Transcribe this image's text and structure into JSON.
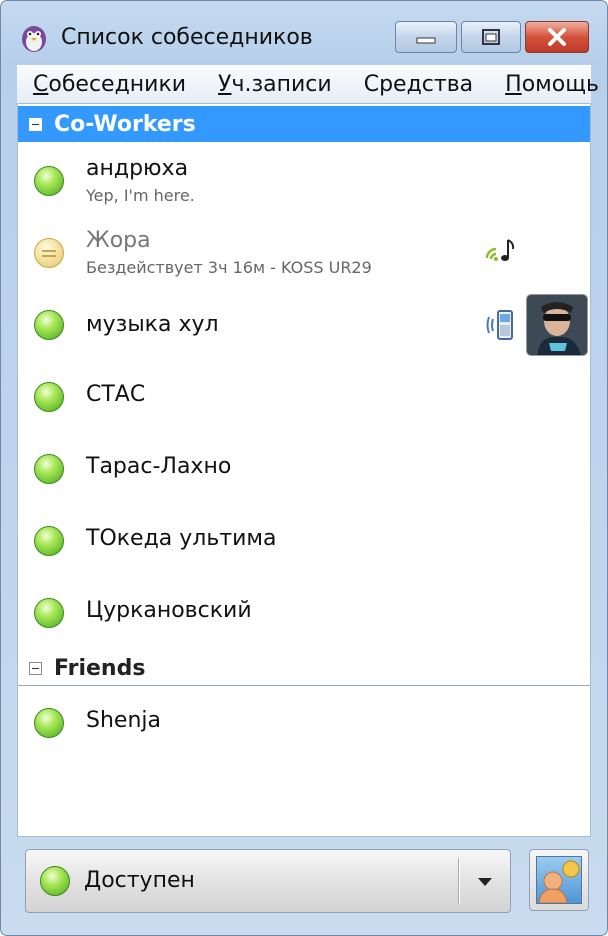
{
  "window": {
    "title": "Список собеседников",
    "buttons": {
      "minimize": "minimize-icon",
      "maximize": "maximize-icon",
      "close": "close-icon"
    }
  },
  "menu": [
    {
      "pre": "",
      "accel": "С",
      "post": "обеседники"
    },
    {
      "pre": "",
      "accel": "У",
      "post": "ч.записи"
    },
    {
      "pre": "Сре",
      "accel": "д",
      "post": "ства"
    },
    {
      "pre": "",
      "accel": "П",
      "post": "омощь"
    }
  ],
  "groups": [
    {
      "name": "Co-Workers",
      "selected": true,
      "contacts": [
        {
          "name": "андрюха",
          "status_text": "Yep, I'm here.",
          "state": "online"
        },
        {
          "name": "Жора",
          "status_text": "Бездействует 3ч 16м - KOSS UR29",
          "state": "idle",
          "icon": "music-note-icon"
        },
        {
          "name": "музыка хул",
          "status_text": "",
          "state": "online",
          "icon": "mobile-phone-icon",
          "avatar": "avatar-photo"
        },
        {
          "name": "СТАС",
          "status_text": "",
          "state": "online"
        },
        {
          "name": "Тарас-Лахно",
          "status_text": "",
          "state": "online"
        },
        {
          "name": "ТОкеда ультима",
          "status_text": "",
          "state": "online"
        },
        {
          "name": "Цуркановский",
          "status_text": "",
          "state": "online"
        }
      ]
    },
    {
      "name": "Friends",
      "selected": false,
      "contacts": [
        {
          "name": "Shenja",
          "status_text": "",
          "state": "online"
        }
      ]
    }
  ],
  "status_selector": {
    "label": "Доступен",
    "state": "online",
    "icon": "chevron-down-icon"
  },
  "photo_button": {
    "icon": "buddy-icon-picture"
  },
  "colors": {
    "selection": "#3399ff",
    "online": "#6bc12f",
    "idle": "#e4c870"
  }
}
